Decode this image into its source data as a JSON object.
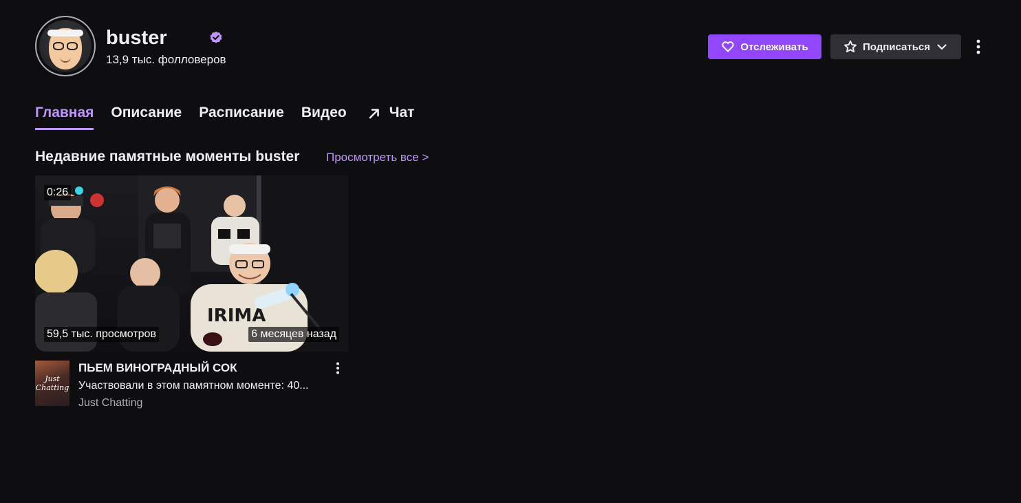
{
  "channel": {
    "name": "buster",
    "followers": "13,9 тыс. фолловеров"
  },
  "actions": {
    "follow_label": "Отслеживать",
    "subscribe_label": "Подписаться"
  },
  "tabs": [
    {
      "label": "Главная",
      "active": true
    },
    {
      "label": "Описание",
      "active": false
    },
    {
      "label": "Расписание",
      "active": false
    },
    {
      "label": "Видео",
      "active": false
    },
    {
      "label": "Чат",
      "active": false
    }
  ],
  "section": {
    "title": "Недавние памятные моменты buster",
    "view_all": "Просмотреть все >"
  },
  "clip": {
    "duration": "0:26",
    "views": "59,5 тыс. просмотров",
    "date": "6 месяцев назад",
    "title": "ПЬЕМ ВИНОГРАДНЫЙ СОК",
    "subtitle": "Участвовали в этом памятном моменте: 40...",
    "category": "Just Chatting",
    "category_art_text": "Just Chatting"
  },
  "colors": {
    "background": "#0e0e10",
    "accent": "#9147ff",
    "accent_light": "#bf94ff",
    "secondary_button": "#2f2f35",
    "muted_text": "#adadb8"
  }
}
